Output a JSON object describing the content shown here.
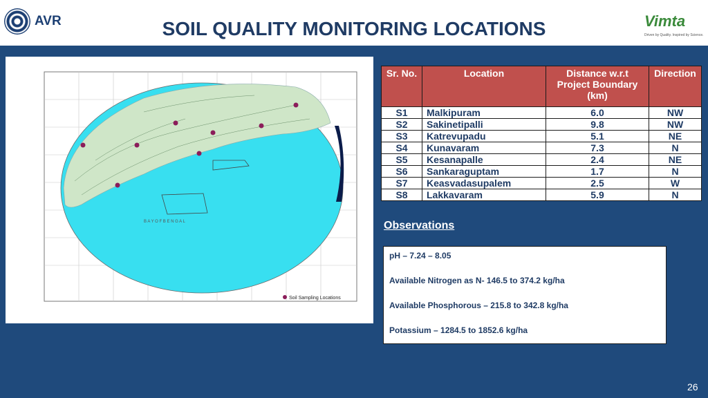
{
  "header": {
    "avr_logo_text": "AVR",
    "title": "SOIL QUALITY MONITORING LOCATIONS",
    "vimta_logo_text": "Vimta",
    "vimta_tagline": "Driven by Quality. Inspired by Science."
  },
  "map": {
    "legend_label": "Soil Sampling Locations",
    "sea_label": "B A Y   O F   B E N G A L",
    "colors": {
      "sea": "#38dff0",
      "land": "#cfe6c8",
      "marker": "#8b1d5a"
    }
  },
  "table": {
    "headers": [
      "Sr. No.",
      "Location",
      "Distance w.r.t Project Boundary (km)",
      "Direction"
    ],
    "rows": [
      [
        "S1",
        "Malkipuram",
        "6.0",
        "NW"
      ],
      [
        "S2",
        "Sakinetipalli",
        "9.8",
        "NW"
      ],
      [
        "S3",
        "Katrevupadu",
        "5.1",
        "NE"
      ],
      [
        "S4",
        "Kunavaram",
        "7.3",
        "N"
      ],
      [
        "S5",
        "Kesanapalle",
        "2.4",
        "NE"
      ],
      [
        "S6",
        "Sankaraguptam",
        "1.7",
        "N"
      ],
      [
        "S7",
        "Keasvadasupalem",
        "2.5",
        "W"
      ],
      [
        "S8",
        "Lakkavaram",
        "5.9",
        "N"
      ]
    ]
  },
  "observations": {
    "heading": "Observations",
    "items": [
      "pH – 7.24 – 8.05",
      "Available Nitrogen as N- 146.5 to 374.2 kg/ha",
      "Available Phosphorous – 215.8 to 342.8 kg/ha",
      "Potassium – 1284.5 to 1852.6  kg/ha"
    ]
  },
  "page_number": "26",
  "colors": {
    "background": "#1f4a7c",
    "table_header": "#c0504d",
    "title": "#1f3b64"
  }
}
